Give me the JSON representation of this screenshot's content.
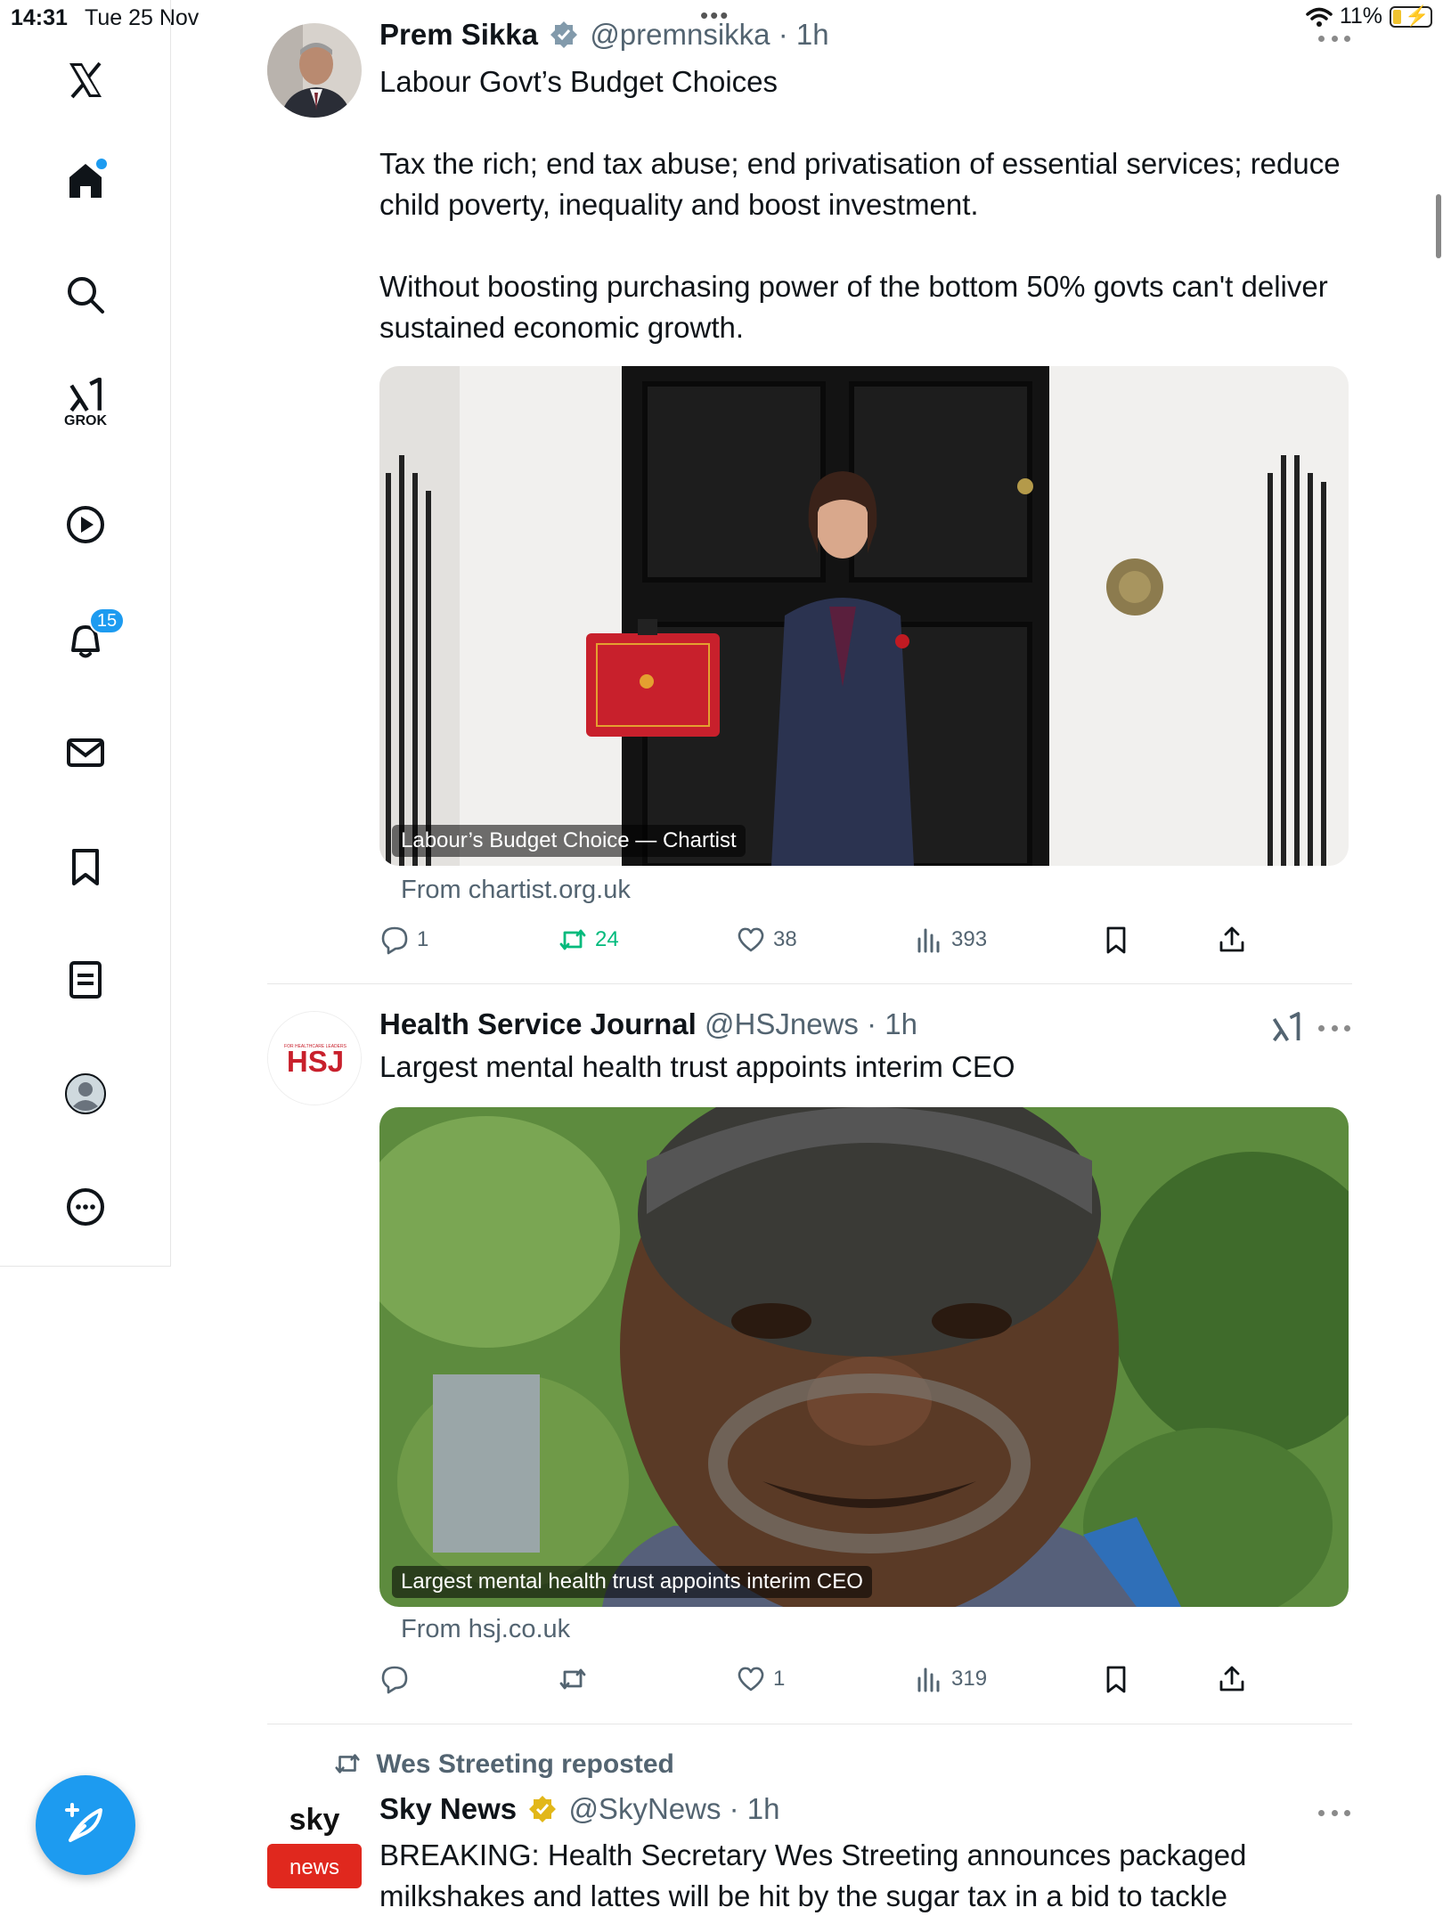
{
  "status_bar": {
    "time": "14:31",
    "date": "Tue 25 Nov",
    "battery": "11%"
  },
  "sidebar": {
    "grok_label": "GROK",
    "notification_count": "15"
  },
  "colors": {
    "accent": "#1d9bf0",
    "retweet_green": "#00ba7c",
    "text_secondary": "#536471"
  },
  "tweets": [
    {
      "name": "Prem Sikka",
      "handle": "@premnsikka",
      "time": "· 1h",
      "text": [
        "Labour Govt’s Budget Choices",
        "",
        "Tax the rich; end tax abuse; end privatisation of essential services; reduce child poverty, inequality and boost investment.",
        "",
        "Without boosting purchasing power of the bottom 50%  govts can't deliver sustained economic growth."
      ],
      "card_caption": "Labour’s Budget Choice — Chartist",
      "card_source": "From chartist.org.uk",
      "replies": "1",
      "reposts": "24",
      "likes": "38",
      "views": "393"
    },
    {
      "name": "Health Service Journal",
      "handle": "@HSJnews",
      "time": "· 1h",
      "avatar_text": "HSJ",
      "avatar_subtext": "FOR HEALTHCARE LEADERS",
      "text": [
        "Largest mental health trust appoints interim CEO"
      ],
      "card_caption": "Largest mental health trust appoints interim CEO",
      "card_source": "From hsj.co.uk",
      "replies": "",
      "reposts": "",
      "likes": "1",
      "views": "319"
    },
    {
      "repost_label": "Wes Streeting reposted",
      "name": "Sky News",
      "handle": "@SkyNews",
      "time": "· 1h",
      "avatar_top": "sky",
      "avatar_bottom": "news",
      "text": [
        "BREAKING: Health Secretary Wes Streeting announces packaged milkshakes and lattes will be hit by the sugar tax in a bid to tackle"
      ]
    }
  ]
}
